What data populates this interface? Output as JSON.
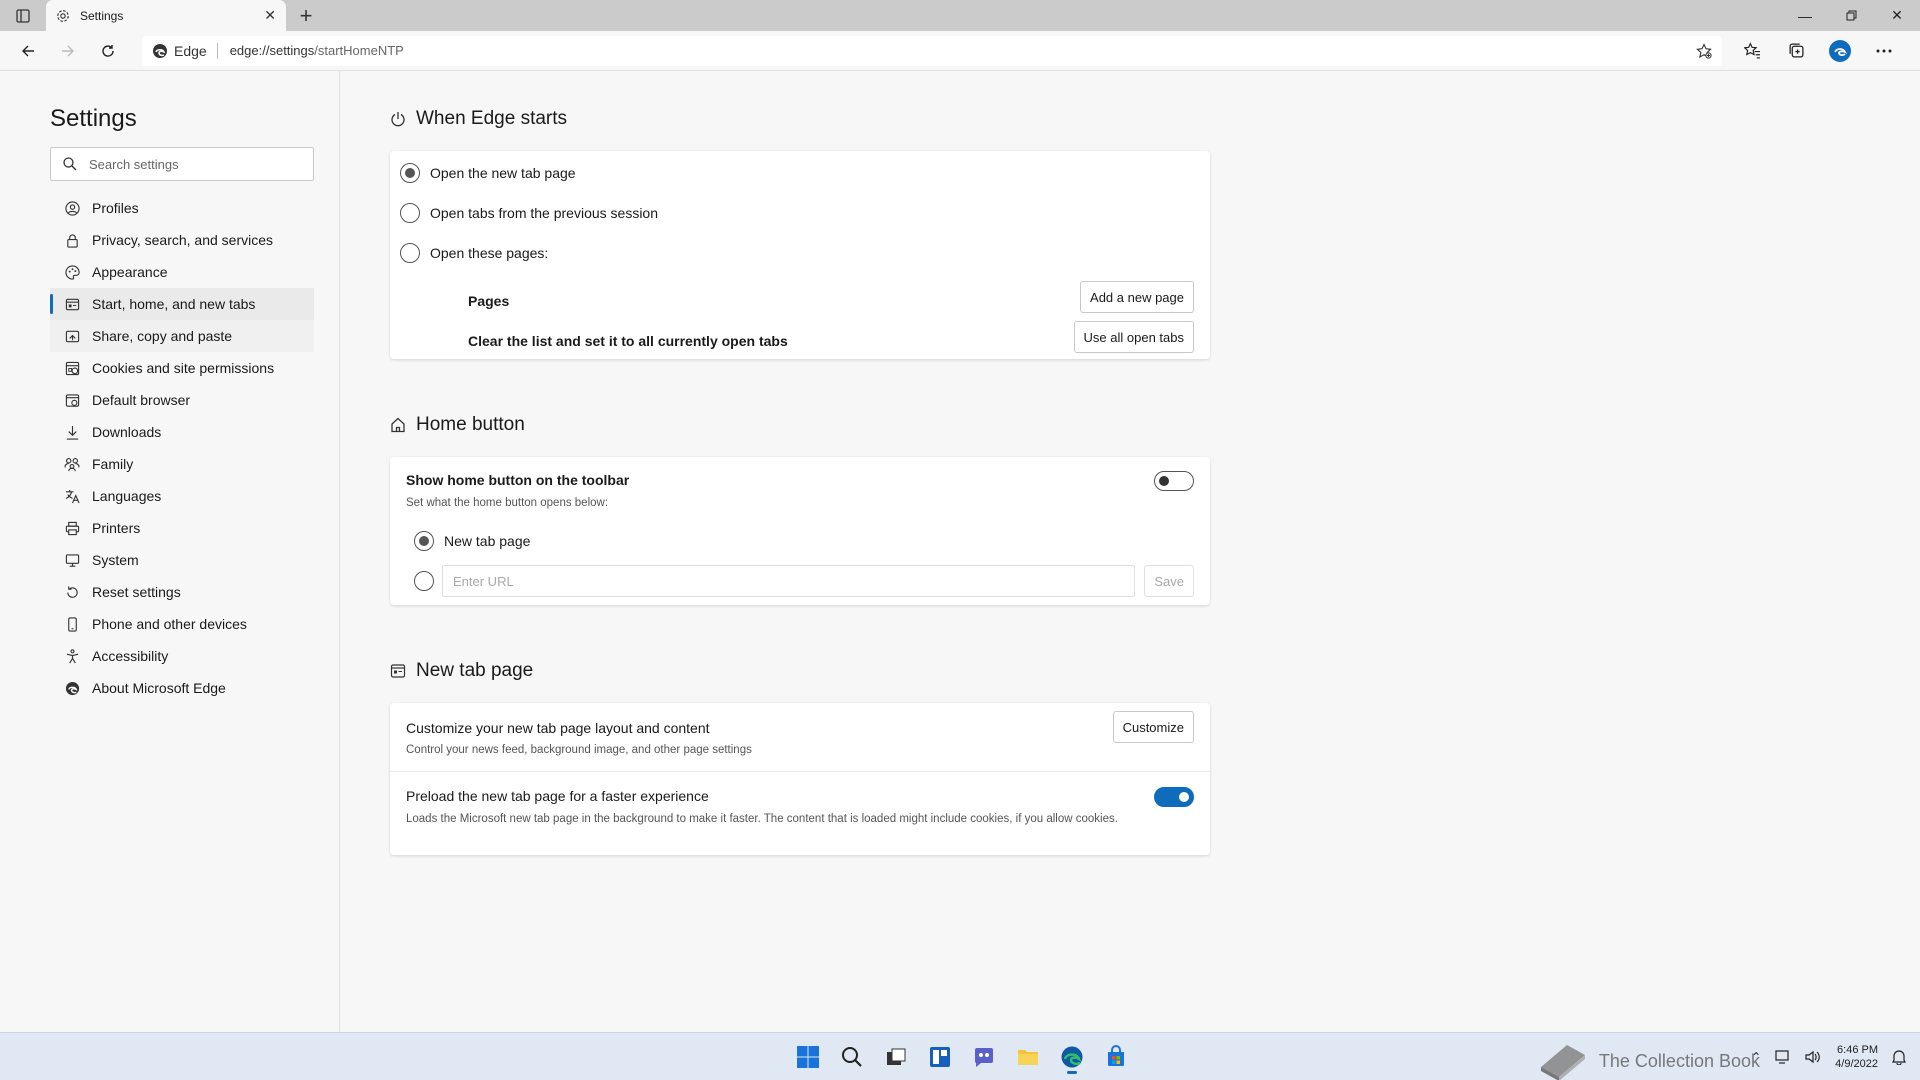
{
  "browser": {
    "tab_title": "Settings",
    "site_label": "Edge",
    "url_host": "edge://settings",
    "url_path": "/startHomeNTP"
  },
  "sidebar": {
    "title": "Settings",
    "search_placeholder": "Search settings",
    "items": [
      {
        "label": "Profiles",
        "icon": "profile-icon"
      },
      {
        "label": "Privacy, search, and services",
        "icon": "lock-icon"
      },
      {
        "label": "Appearance",
        "icon": "palette-icon"
      },
      {
        "label": "Start, home, and new tabs",
        "icon": "start-tabs-icon",
        "active": true
      },
      {
        "label": "Share, copy and paste",
        "icon": "share-icon"
      },
      {
        "label": "Cookies and site permissions",
        "icon": "cookie-icon"
      },
      {
        "label": "Default browser",
        "icon": "browser-icon"
      },
      {
        "label": "Downloads",
        "icon": "download-icon"
      },
      {
        "label": "Family",
        "icon": "family-icon"
      },
      {
        "label": "Languages",
        "icon": "languages-icon"
      },
      {
        "label": "Printers",
        "icon": "printer-icon"
      },
      {
        "label": "System",
        "icon": "system-icon"
      },
      {
        "label": "Reset settings",
        "icon": "reset-icon"
      },
      {
        "label": "Phone and other devices",
        "icon": "phone-icon"
      },
      {
        "label": "Accessibility",
        "icon": "accessibility-icon"
      },
      {
        "label": "About Microsoft Edge",
        "icon": "edge-logo-icon"
      }
    ]
  },
  "when_edge_starts": {
    "heading": "When Edge starts",
    "options": [
      {
        "label": "Open the new tab page",
        "checked": true
      },
      {
        "label": "Open tabs from the previous session",
        "checked": false
      },
      {
        "label": "Open these pages:",
        "checked": false
      }
    ],
    "pages_label": "Pages",
    "add_page_button": "Add a new page",
    "clear_list_label": "Clear the list and set it to all currently open tabs",
    "use_open_tabs_button": "Use all open tabs"
  },
  "home_button": {
    "heading": "Home button",
    "title": "Show home button on the toolbar",
    "description": "Set what the home button opens below:",
    "toggle_on": false,
    "option_new_tab": "New tab page",
    "url_placeholder": "Enter URL",
    "save_button": "Save"
  },
  "new_tab_page": {
    "heading": "New tab page",
    "customize_title": "Customize your new tab page layout and content",
    "customize_desc": "Control your news feed, background image, and other page settings",
    "customize_button": "Customize",
    "preload_title": "Preload the new tab page for a faster experience",
    "preload_desc": "Loads the Microsoft new tab page in the background to make it faster. The content that is loaded might include cookies, if you allow cookies.",
    "preload_on": true
  },
  "taskbar": {
    "watermark": "The Collection Book",
    "time": "6:46 PM",
    "date": "4/9/2022"
  },
  "colors": {
    "accent": "#0f6cbd",
    "edge_blue": "#0c59a4",
    "edge_green": "#33bf6a"
  }
}
